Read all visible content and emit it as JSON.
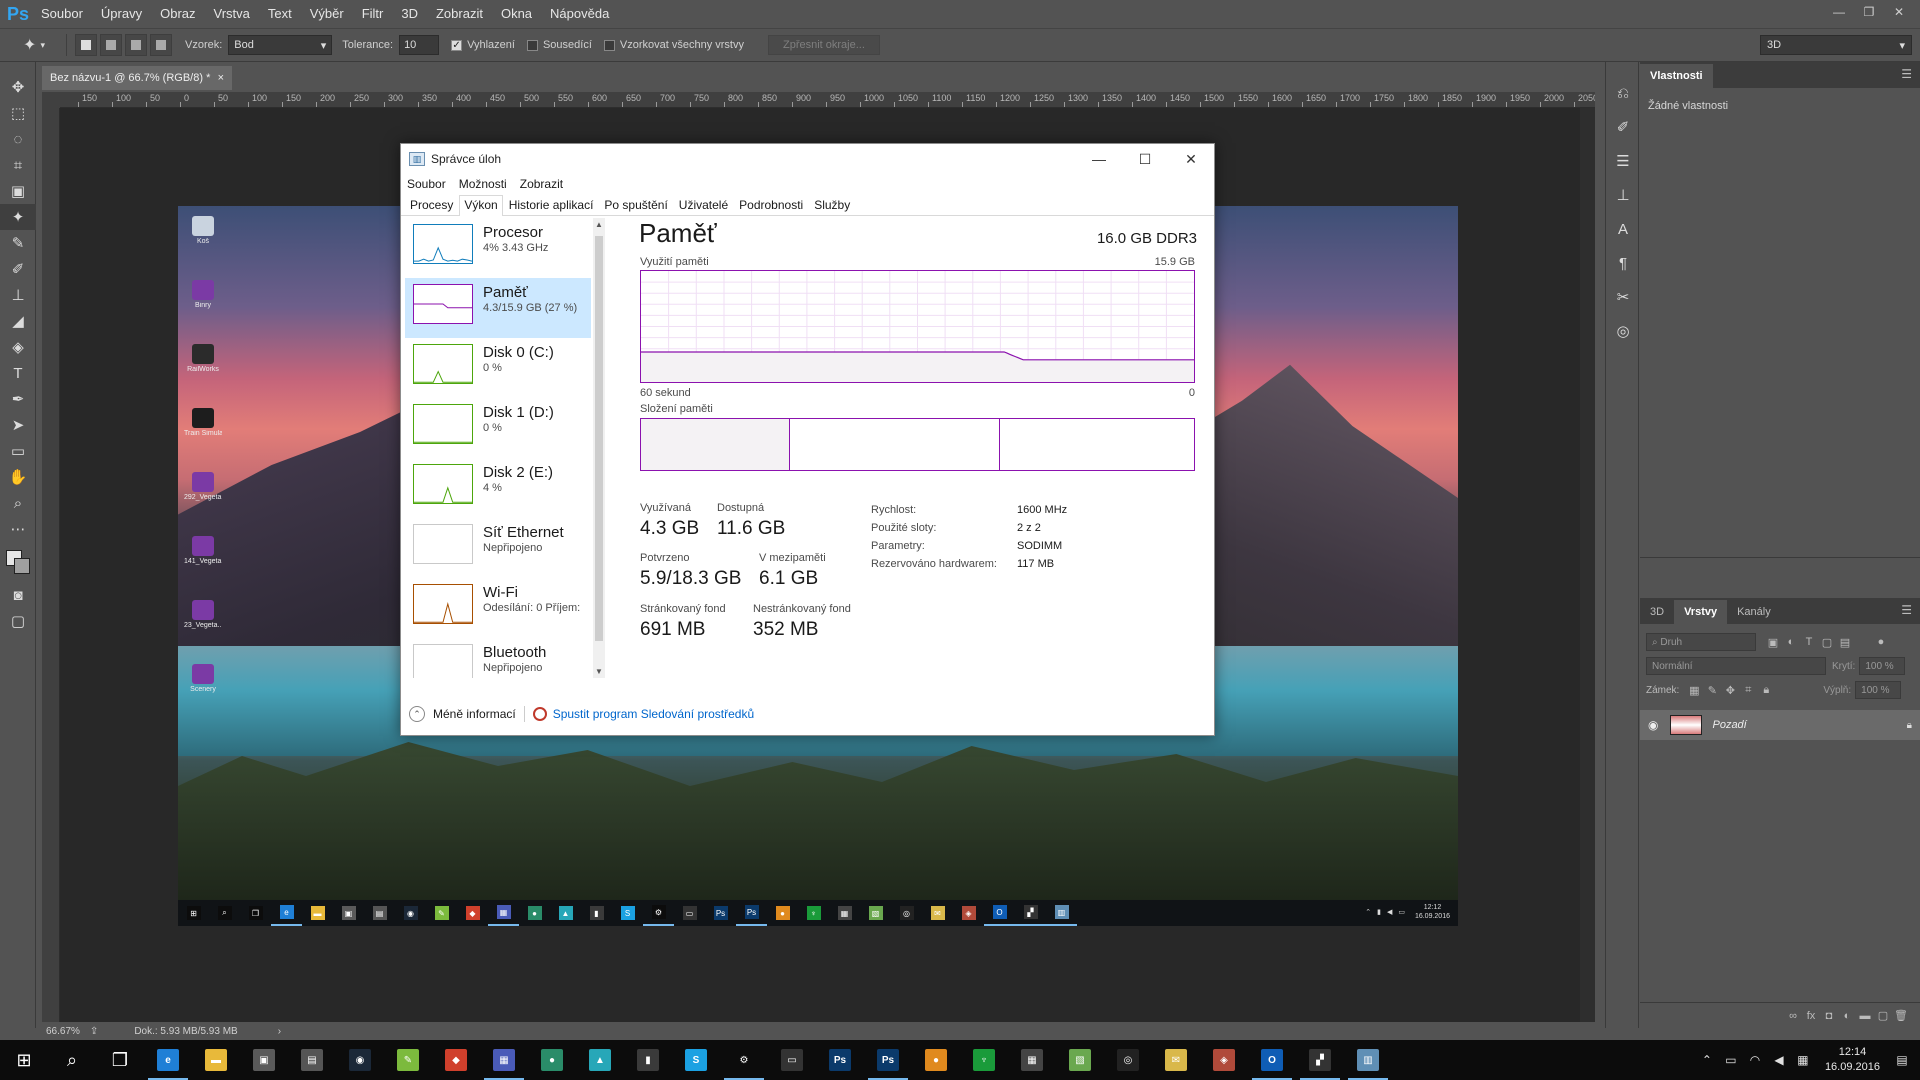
{
  "photoshop": {
    "logo": "Ps",
    "menu": [
      "Soubor",
      "Úpravy",
      "Obraz",
      "Vrstva",
      "Text",
      "Výběr",
      "Filtr",
      "3D",
      "Zobrazit",
      "Okna",
      "Nápověda"
    ],
    "window_controls": {
      "minimize": "—",
      "restore": "❐",
      "close": "✕"
    },
    "options": {
      "sample_label": "Vzorek:",
      "sample_value": "Bod",
      "tolerance_label": "Tolerance:",
      "tolerance_value": "10",
      "antialias_label": "Vyhlazení",
      "antialias_checked": true,
      "contiguous_label": "Sousedící",
      "contiguous_checked": false,
      "all_layers_label": "Vzorkovat všechny vrstvy",
      "all_layers_checked": false,
      "refine_edge_label": "Zpřesnit okraje...",
      "workspace_value": "3D"
    },
    "document_tab": {
      "title": "Bez názvu-1 @ 66.7% (RGB/8) *",
      "close": "×"
    },
    "ruler_top_labels": [
      "150",
      "100",
      "50",
      "0",
      "50",
      "100",
      "150",
      "200",
      "250",
      "300",
      "350",
      "400",
      "450",
      "500",
      "550",
      "600",
      "650",
      "700",
      "750",
      "800",
      "850",
      "900",
      "950",
      "1000",
      "1050",
      "1100",
      "1150",
      "1200",
      "1250",
      "1300",
      "1350",
      "1400",
      "1450",
      "1500",
      "1550",
      "1600",
      "1650",
      "1700",
      "1750",
      "1800",
      "1850",
      "1900",
      "1950",
      "2000",
      "2050"
    ],
    "status": {
      "zoom": "66.67%",
      "doc": "Dok.: 5.93 MB/5.93 MB",
      "arrow": "›"
    },
    "properties_panel": {
      "tab": "Vlastnosti",
      "body": "Žádné vlastnosti"
    },
    "layers_panel": {
      "tabs": [
        "3D",
        "Vrstvy",
        "Kanály"
      ],
      "active_tab": "Vrstvy",
      "kind_placeholder": "Druh",
      "blend_mode": "Normální",
      "opacity_label": "Krytí:",
      "opacity_value": "100 %",
      "lock_label": "Zámek:",
      "fill_label": "Výplň:",
      "fill_value": "100 %",
      "layer_name": "Pozadí"
    }
  },
  "desktop_icons": [
    {
      "label": "Koš",
      "color": "#c9d3df"
    },
    {
      "label": "Binry",
      "color": "#7b3aa5"
    },
    {
      "label": "RailWorks",
      "color": "#2b2b2b"
    },
    {
      "label": "Train Simulator",
      "color": "#1d1d1d"
    },
    {
      "label": "292_Vegeta...",
      "color": "#7b3aa5"
    },
    {
      "label": "141_Vegeta...",
      "color": "#7b3aa5"
    },
    {
      "label": "23_Vegeta...",
      "color": "#7b3aa5"
    },
    {
      "label": "Scenery",
      "color": "#7b3aa5"
    }
  ],
  "inner_taskbar": {
    "time": "12:12",
    "date": "16.09.2016"
  },
  "task_manager": {
    "title": "Správce úloh",
    "menu": [
      "Soubor",
      "Možnosti",
      "Zobrazit"
    ],
    "tabs": [
      "Procesy",
      "Výkon",
      "Historie aplikací",
      "Po spuštění",
      "Uživatelé",
      "Podrobnosti",
      "Služby"
    ],
    "active_tab": "Výkon",
    "window_controls": {
      "minimize": "—",
      "maximize": "☐",
      "close": "✕"
    },
    "sidebar": [
      {
        "title": "Procesor",
        "sub": "4% 3.43 GHz",
        "color": "#117dbb"
      },
      {
        "title": "Paměť",
        "sub": "4.3/15.9 GB (27 %)",
        "color": "#8b12ae"
      },
      {
        "title": "Disk 0 (C:)",
        "sub": "0 %",
        "color": "#4da60c"
      },
      {
        "title": "Disk 1 (D:)",
        "sub": "0 %",
        "color": "#4da60c"
      },
      {
        "title": "Disk 2 (E:)",
        "sub": "4 %",
        "color": "#4da60c"
      },
      {
        "title": "Síť Ethernet",
        "sub": "Nepřipojeno",
        "color": "#c9c9c9"
      },
      {
        "title": "Wi-Fi",
        "sub": "Odesílání: 0 Příjem:",
        "color": "#a74f01"
      },
      {
        "title": "Bluetooth",
        "sub": "Nepřipojeno",
        "color": "#c9c9c9"
      }
    ],
    "memory": {
      "title": "Paměť",
      "total": "16.0 GB DDR3",
      "usage_label": "Využití paměti",
      "usage_max": "15.9 GB",
      "time_left": "60 sekund",
      "time_right": "0",
      "composition_label": "Složení paměti",
      "in_use_label": "Využívaná",
      "in_use": "4.3 GB",
      "available_label": "Dostupná",
      "available": "11.6 GB",
      "committed_label": "Potvrzeno",
      "committed": "5.9/18.3 GB",
      "cached_label": "V mezipaměti",
      "cached": "6.1 GB",
      "paged_label": "Stránkovaný fond",
      "paged": "691 MB",
      "nonpaged_label": "Nestránkovaný fond",
      "nonpaged": "352 MB",
      "speed_label": "Rychlost:",
      "speed": "1600 MHz",
      "slots_label": "Použité sloty:",
      "slots": "2 z 2",
      "form_label": "Parametry:",
      "form": "SODIMM",
      "reserved_label": "Rezervováno hardwarem:",
      "reserved": "117 MB",
      "usage_history_fraction": [
        0.27,
        0.27,
        0.27,
        0.27,
        0.27,
        0.27,
        0.27,
        0.27,
        0.27,
        0.27,
        0.27,
        0.27,
        0.27,
        0.27,
        0.27,
        0.27,
        0.27,
        0.27,
        0.27,
        0.27,
        0.27,
        0.27,
        0.27,
        0.27,
        0.27,
        0.27,
        0.27,
        0.27,
        0.27,
        0.27,
        0.27,
        0.27,
        0.27,
        0.27,
        0.27,
        0.27,
        0.27,
        0.27,
        0.27,
        0.27,
        0.27,
        0.27,
        0.27,
        0.27,
        0.27,
        0.27,
        0.27,
        0.27,
        0.27,
        0.27,
        0.27,
        0.27,
        0.27,
        0.27,
        0.27,
        0.27,
        0.27,
        0.27,
        0.27,
        0.27,
        0.27,
        0.27,
        0.27,
        0.27,
        0.27,
        0.27,
        0.27,
        0.27,
        0.27,
        0.27,
        0.27,
        0.27,
        0.27,
        0.27,
        0.27,
        0.27,
        0.27,
        0.27,
        0.27,
        0.27,
        0.27,
        0.27,
        0.27,
        0.27,
        0.27,
        0.27,
        0.27,
        0.27,
        0.27,
        0.27,
        0.27,
        0.27,
        0.27,
        0.27,
        0.27,
        0.27,
        0.27,
        0.27,
        0.27,
        0.27,
        0.27,
        0.27,
        0.27,
        0.27,
        0.27,
        0.27,
        0.27,
        0.27,
        0.27,
        0.27,
        0.27,
        0.27,
        0.27,
        0.27,
        0.27,
        0.27,
        0.27,
        0.27,
        0.27,
        0.27,
        0.27,
        0.27,
        0.27,
        0.27,
        0.27,
        0.27,
        0.27,
        0.27,
        0.27,
        0.27,
        0.27,
        0.27,
        0.27,
        0.27,
        0.27,
        0.26,
        0.25,
        0.24,
        0.23,
        0.22,
        0.21,
        0.2,
        0.2,
        0.2,
        0.2,
        0.2,
        0.2,
        0.2,
        0.2,
        0.2,
        0.2,
        0.2,
        0.2,
        0.2,
        0.2,
        0.2,
        0.2,
        0.2,
        0.2,
        0.2,
        0.2,
        0.2,
        0.2,
        0.2,
        0.2,
        0.2,
        0.2,
        0.2,
        0.2,
        0.2,
        0.2,
        0.2,
        0.2,
        0.2,
        0.2,
        0.2,
        0.2,
        0.2,
        0.2,
        0.2,
        0.2,
        0.2,
        0.2,
        0.2,
        0.2,
        0.2,
        0.2,
        0.2,
        0.2,
        0.2,
        0.2,
        0.2,
        0.2,
        0.2,
        0.2,
        0.2,
        0.2,
        0.2,
        0.2,
        0.2,
        0.2,
        0.2,
        0.2,
        0.2,
        0.2
      ],
      "composition_fractions": [
        0.27,
        0.38,
        0.35
      ]
    },
    "footer": {
      "less_info": "Méně informací",
      "resmon_link": "Spustit program Sledování prostředků"
    }
  },
  "taskbar": {
    "apps": [
      {
        "name": "start",
        "glyph": "⊞",
        "color": "#0c0c0c",
        "open": false
      },
      {
        "name": "search",
        "glyph": "⌕",
        "color": "#0c0c0c",
        "open": false
      },
      {
        "name": "task-view",
        "glyph": "❐",
        "color": "#0c0c0c",
        "open": false
      },
      {
        "name": "edge",
        "glyph": "e",
        "color": "#1f7fd6",
        "open": true
      },
      {
        "name": "explorer",
        "glyph": "▬",
        "color": "#e8b93a",
        "open": false
      },
      {
        "name": "store",
        "glyph": "▣",
        "color": "#5a5a5a",
        "open": false
      },
      {
        "name": "app-1",
        "glyph": "▤",
        "color": "#555",
        "open": false
      },
      {
        "name": "steam",
        "glyph": "◉",
        "color": "#1b2838",
        "open": false
      },
      {
        "name": "notepad",
        "glyph": "✎",
        "color": "#7cba3d",
        "open": false
      },
      {
        "name": "app-2",
        "glyph": "◆",
        "color": "#d0402c",
        "open": false
      },
      {
        "name": "save-app",
        "glyph": "▦",
        "color": "#4a5bb8",
        "open": true
      },
      {
        "name": "app-3",
        "glyph": "●",
        "color": "#2a8c69",
        "open": false
      },
      {
        "name": "app-4",
        "glyph": "▲",
        "color": "#27a7b8",
        "open": false
      },
      {
        "name": "app-5",
        "glyph": "▮",
        "color": "#3a3a3a",
        "open": false
      },
      {
        "name": "skype",
        "glyph": "S",
        "color": "#1ba1e2",
        "open": false
      },
      {
        "name": "settings",
        "glyph": "⚙",
        "color": "#0c0c0c",
        "open": true
      },
      {
        "name": "app-6",
        "glyph": "▭",
        "color": "#333",
        "open": false
      },
      {
        "name": "photoshop",
        "glyph": "Ps",
        "color": "#0b3a6b",
        "open": false
      },
      {
        "name": "photoshop-2",
        "glyph": "Ps",
        "color": "#0b3a6b",
        "open": true
      },
      {
        "name": "app-7",
        "glyph": "●",
        "color": "#e08a1e",
        "open": false
      },
      {
        "name": "app-8",
        "glyph": "♆",
        "color": "#1a9b3a",
        "open": false
      },
      {
        "name": "calculator",
        "glyph": "▦",
        "color": "#444",
        "open": false
      },
      {
        "name": "app-9",
        "glyph": "▧",
        "color": "#6aa84f",
        "open": false
      },
      {
        "name": "app-10",
        "glyph": "◎",
        "color": "#222",
        "open": false
      },
      {
        "name": "app-11",
        "glyph": "✉",
        "color": "#d9b84a",
        "open": false
      },
      {
        "name": "app-12",
        "glyph": "◈",
        "color": "#b04a3a",
        "open": false
      },
      {
        "name": "outlook",
        "glyph": "O",
        "color": "#0f5db5",
        "open": true
      },
      {
        "name": "app-13",
        "glyph": "▞",
        "color": "#333",
        "open": true
      },
      {
        "name": "task-manager",
        "glyph": "▥",
        "color": "#5f8fb5",
        "open": true
      }
    ],
    "time": "12:14",
    "date": "16.09.2016"
  }
}
